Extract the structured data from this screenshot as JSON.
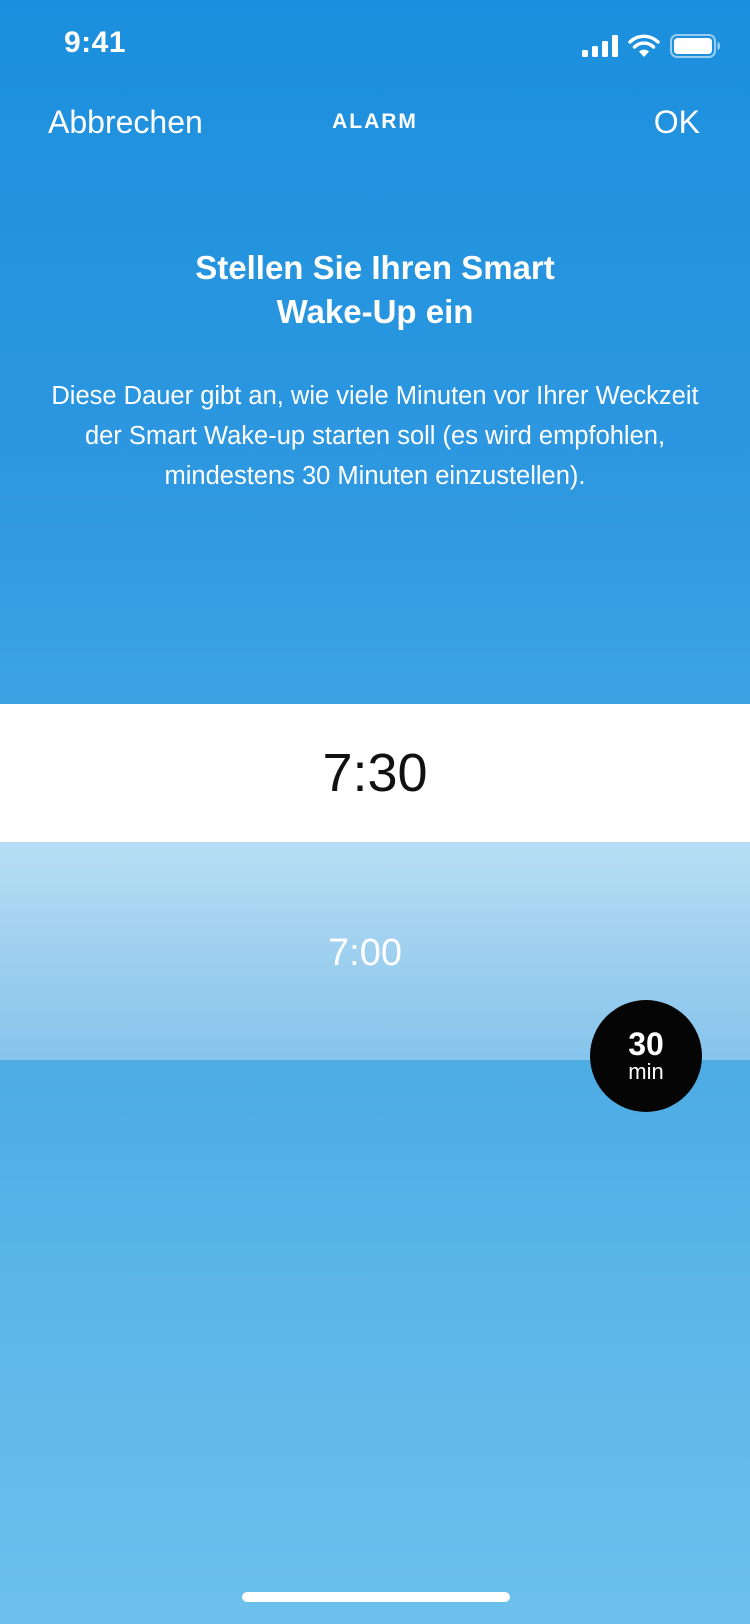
{
  "status_bar": {
    "time": "9:41",
    "icons": [
      "signal-icon",
      "wifi-icon",
      "battery-icon"
    ]
  },
  "nav": {
    "cancel_label": "Abbrechen",
    "title": "ALARM",
    "ok_label": "OK"
  },
  "headline": {
    "line1": "Stellen Sie Ihren Smart",
    "line2": "Wake-Up ein"
  },
  "description": "Diese Dauer gibt an, wie viele Minuten vor Ihrer Weckzeit der Smart Wake-up starten soll (es wird empfohlen, mindestens 30 Minuten einzustellen).",
  "picker": {
    "alarm_time": "7:30",
    "wake_start_time": "7:00"
  },
  "badge": {
    "value": "30",
    "unit": "min"
  },
  "colors": {
    "background_top": "#1b8fdd",
    "background_bottom": "#6cc1ec",
    "range_band": "#a6d4f0",
    "badge": "#050505"
  }
}
